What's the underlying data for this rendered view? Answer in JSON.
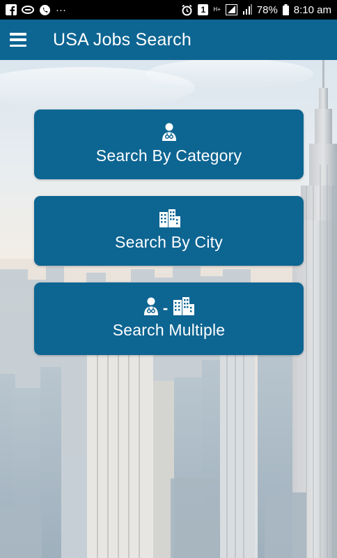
{
  "status_bar": {
    "battery": "78%",
    "time": "8:10 am",
    "overflow": "···",
    "notification_count": "1",
    "network_type": "H+"
  },
  "app_bar": {
    "title": "USA Jobs Search"
  },
  "cards": [
    {
      "label": "Search By Category",
      "icons": [
        "doctor-icon"
      ]
    },
    {
      "label": "Search By City",
      "icons": [
        "buildings-icon"
      ]
    },
    {
      "label": "Search Multiple",
      "icons": [
        "doctor-icon",
        "buildings-icon"
      ],
      "separator": "-"
    }
  ],
  "colors": {
    "primary": "#0d6592",
    "status_bar": "#000000",
    "text_on_primary": "#ffffff"
  }
}
